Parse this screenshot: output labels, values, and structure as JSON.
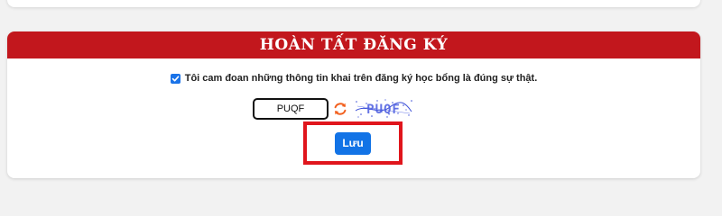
{
  "section": {
    "title": "HOÀN TẤT ĐĂNG KÝ"
  },
  "consent": {
    "checked": true,
    "label": "Tôi cam đoan những thông tin khai trên đăng ký học bổng là đúng sự thật."
  },
  "captcha": {
    "input_value": "PUQF",
    "refresh_icon": "refresh-icon",
    "image_text": "PUQF"
  },
  "actions": {
    "save_label": "Lưu"
  },
  "colors": {
    "header_bg": "#c2171d",
    "button_bg": "#1273e6",
    "highlight_border": "#e0151c",
    "refresh_orange": "#f2601e"
  }
}
